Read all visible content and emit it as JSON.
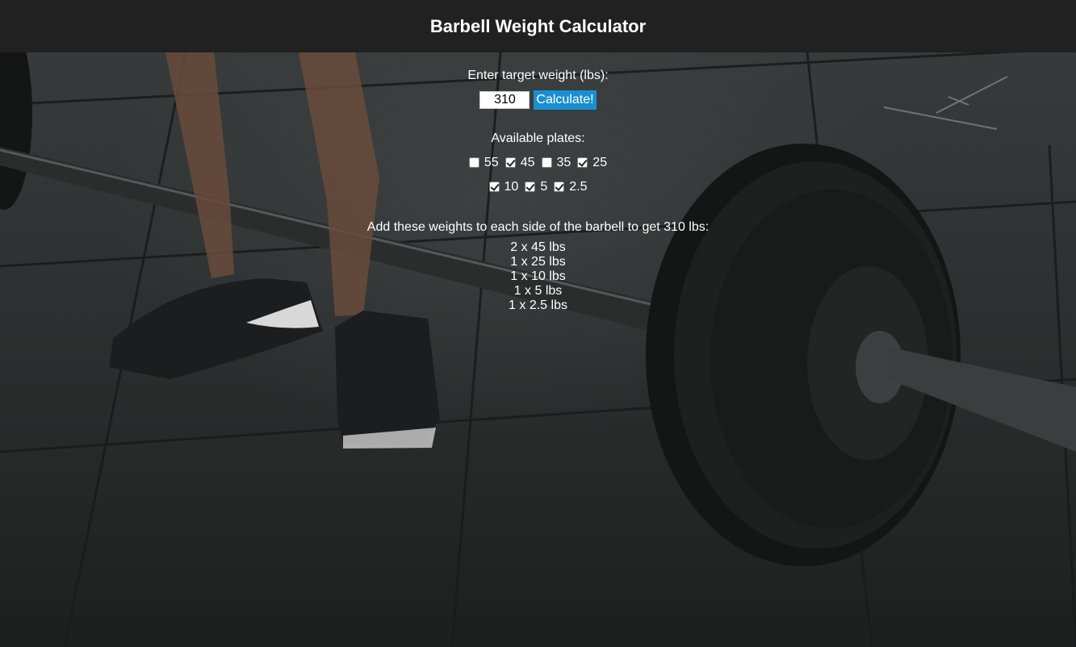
{
  "header": {
    "title": "Barbell Weight Calculator"
  },
  "form": {
    "target_label": "Enter target weight (lbs):",
    "target_value": "310",
    "calculate_label": "Calculate!",
    "plates_label": "Available plates:",
    "plates_row_1": [
      {
        "label": "55",
        "checked": false
      },
      {
        "label": "45",
        "checked": true
      },
      {
        "label": "35",
        "checked": false
      },
      {
        "label": "25",
        "checked": true
      }
    ],
    "plates_row_2": [
      {
        "label": "10",
        "checked": true
      },
      {
        "label": "5",
        "checked": true
      },
      {
        "label": "2.5",
        "checked": true
      }
    ]
  },
  "result": {
    "heading": "Add these weights to each side of the barbell to get 310 lbs:",
    "lines": [
      "2 x 45 lbs",
      "1 x 25 lbs",
      "1 x 10 lbs",
      "1 x 5 lbs",
      "1 x 2.5 lbs"
    ]
  },
  "background": {
    "image": "gym-floor-barbell-photo"
  }
}
